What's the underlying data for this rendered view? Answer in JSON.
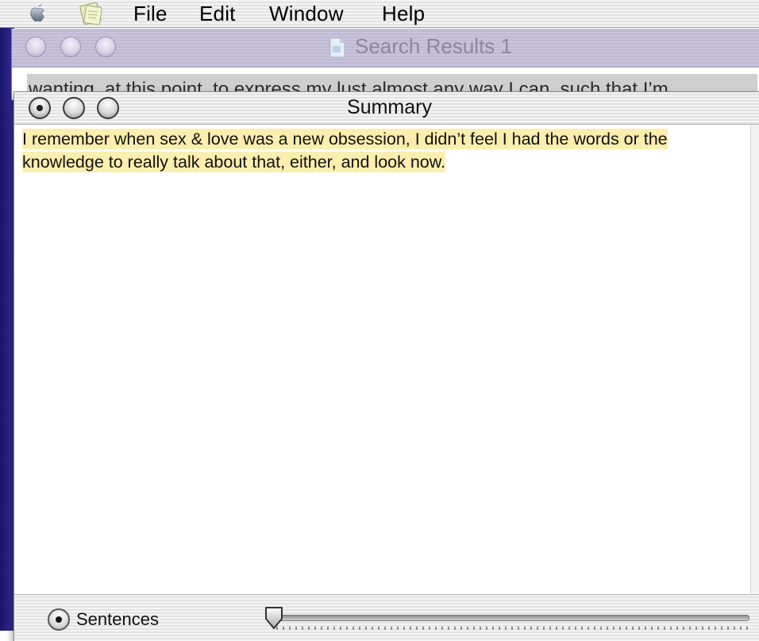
{
  "menubar": {
    "apple_icon": "apple-logo-icon",
    "app_icon": "application-icon",
    "items": [
      {
        "label": "File"
      },
      {
        "label": "Edit"
      },
      {
        "label": "Window"
      },
      {
        "label": "Help"
      }
    ]
  },
  "background_window": {
    "title": "Search Results 1",
    "icon": "document-icon",
    "visible_text": "wanting, at this point, to express my lust almost any way I can, such that I’m"
  },
  "summary_window": {
    "title": "Summary",
    "text": "I remember when sex & love was a new obsession, I didn’t feel I had the words or the knowledge to really talk about that, either, and look now.",
    "highlight_color": "#fbeeae",
    "mode_option": "Sentences",
    "mode_selected": true,
    "slider_level": 0
  },
  "colors": {
    "desktop": "#2a2285",
    "bg_titlebar": "#c9c3dc",
    "highlight": "#fbeeae"
  }
}
